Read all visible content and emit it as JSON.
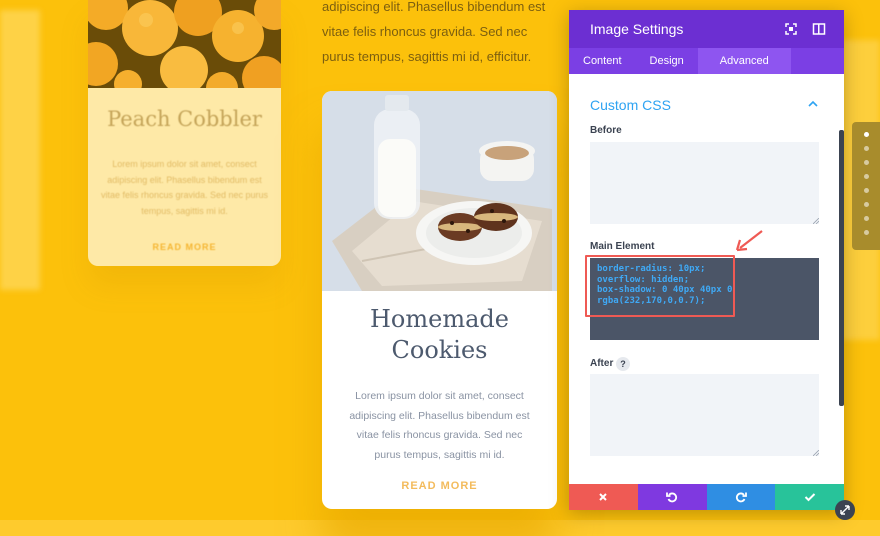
{
  "background": {
    "top_paragraph": "adipiscing elit. Phasellus bibendum est vitae felis rhoncus gravida. Sed nec purus tempus, sagittis mi id, efficitur."
  },
  "peach_card": {
    "title": "Peach Cobbler",
    "text": "Lorem ipsum dolor sit amet, consect adipiscing elit. Phasellus bibendum est vitae felis rhoncus gravida. Sed nec purus tempus, sagittis mi id.",
    "read_more": "READ MORE"
  },
  "cookie_card": {
    "title": "Homemade Cookies",
    "text": "Lorem ipsum dolor sit amet, consect adipiscing elit. Phasellus bibendum est vitae felis rhoncus gravida. Sed nec purus tempus, sagittis mi id.",
    "read_more": "READ MORE"
  },
  "panel": {
    "title": "Image Settings",
    "tabs": [
      {
        "label": "Content"
      },
      {
        "label": "Design"
      },
      {
        "label": "Advanced"
      }
    ],
    "active_tab": "Advanced",
    "section_title": "Custom CSS",
    "fields": {
      "before_label": "Before",
      "before_value": "",
      "main_label": "Main Element",
      "main_value": "border-radius: 10px;\noverflow: hidden;\nbox-shadow: 0 40px 40px 0\nrgba(232,170,0,0.7);",
      "after_label": "After",
      "after_value": "",
      "help_label": "?"
    }
  },
  "icons": {
    "expand": "expand-icon",
    "sidebar": "sidebar-toggle-icon",
    "collapse": "chevron-up-icon",
    "discard": "close-icon",
    "undo": "undo-icon",
    "redo": "redo-icon",
    "save": "check-icon",
    "resize": "resize-icon"
  },
  "colors": {
    "panel_header": "#6c2fd2",
    "tab_bar": "#7b3fe4",
    "accent_blue": "#2ea3f2",
    "discard": "#ef5a54",
    "undo": "#7f39e0",
    "redo": "#2f8ee3",
    "save": "#28c39a",
    "background": "#fcc10b"
  },
  "dot_nav": {
    "count": 8,
    "active_index": 0
  }
}
